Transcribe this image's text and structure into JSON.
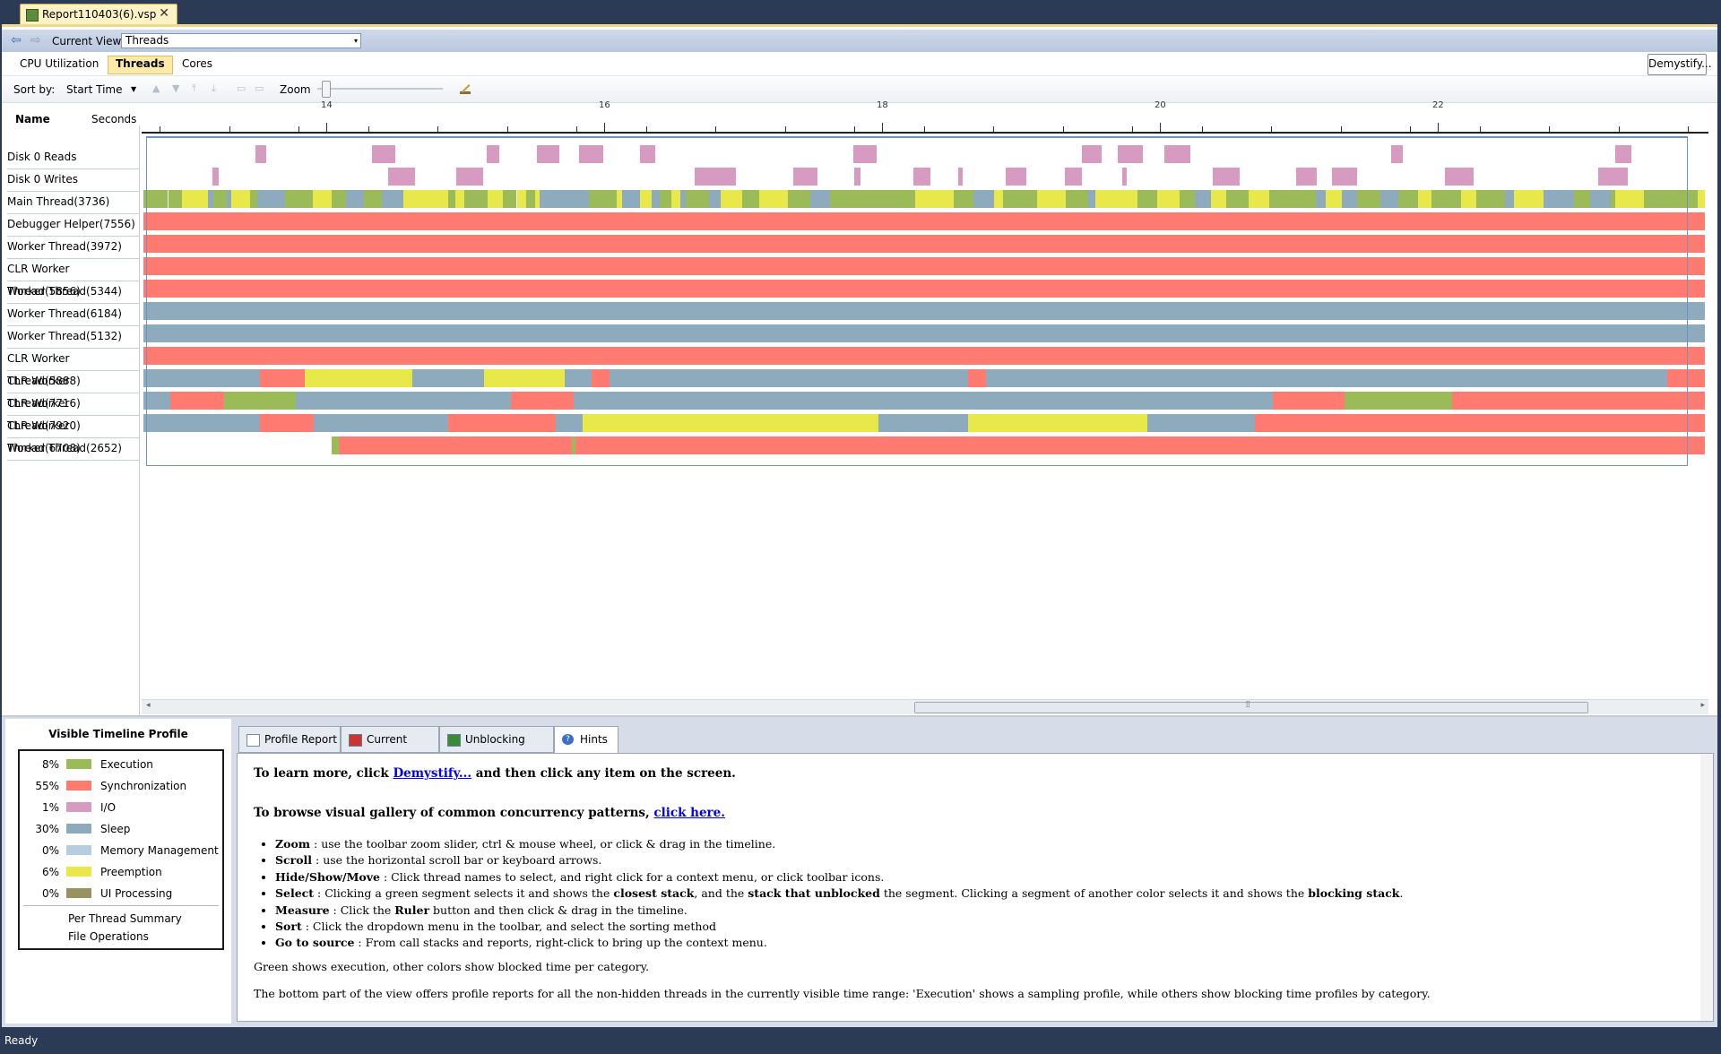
{
  "doc_tab": {
    "title": "Report110403(6).vsp",
    "close": "✕"
  },
  "view_bar": {
    "back": "⇦",
    "forward": "⇨",
    "label": "Current View:",
    "value": "Threads",
    "arrow": "▾"
  },
  "view_tabs": {
    "cpu": "CPU Utilization",
    "threads": "Threads",
    "cores": "Cores",
    "demystify": "Demystify..."
  },
  "toolbar": {
    "sort_label": "Sort by:",
    "sort_value": "Start Time",
    "zoom_label": "Zoom"
  },
  "header": {
    "name": "Name",
    "seconds": "Seconds"
  },
  "axis": {
    "ticks": [
      "14",
      "16",
      "18",
      "20",
      "22"
    ]
  },
  "threads": [
    "Disk 0 Reads",
    "Disk 0 Writes",
    "Main Thread(3736)",
    "Debugger Helper(7556)",
    "Worker Thread(3972)",
    "CLR Worker Thread(5856)",
    "Worker Thread(5344)",
    "Worker Thread(6184)",
    "Worker Thread(5132)",
    "CLR Worker Thread(5888)",
    "CLR Worker Thread(7716)",
    "CLR Worker Thread(7920)",
    "CLR Worker Thread(6708)",
    "Worker Thread(2652)"
  ],
  "colors": {
    "execution": "#9bbb59",
    "synchronization": "#ff7b72",
    "io": "#d79ac0",
    "sleep": "#8eaabd",
    "memory": "#b9cde0",
    "preemption": "#e8e84a",
    "ui": "#9a9161"
  },
  "profile": {
    "title": "Visible Timeline Profile",
    "legend": [
      {
        "pct": "8%",
        "name": "Execution",
        "color": "#9bbb59"
      },
      {
        "pct": "55%",
        "name": "Synchronization",
        "color": "#ff7b72"
      },
      {
        "pct": "1%",
        "name": "I/O",
        "color": "#d79ac0"
      },
      {
        "pct": "30%",
        "name": "Sleep",
        "color": "#8eaabd"
      },
      {
        "pct": "0%",
        "name": "Memory Management",
        "color": "#b9cde0"
      },
      {
        "pct": "6%",
        "name": "Preemption",
        "color": "#e8e84a"
      },
      {
        "pct": "0%",
        "name": "UI Processing",
        "color": "#9a9161"
      }
    ],
    "links": [
      "Per Thread Summary",
      "File Operations"
    ]
  },
  "report_tabs": [
    "Profile Report",
    "Current stack",
    "Unblocking stack",
    "Hints"
  ],
  "hints": {
    "l1_pre": "To learn more, click ",
    "l1_link": "Demystify...",
    "l1_post": " and then click any item on the screen.",
    "l2_pre": "To browse visual gallery of common concurrency patterns, ",
    "l2_link": "click here.",
    "bullets": [
      {
        "b": "Zoom",
        "t": " : use the toolbar zoom slider, ctrl & mouse wheel, or click & drag in the timeline."
      },
      {
        "b": "Scroll",
        "t": " : use the horizontal scroll bar or keyboard arrows."
      },
      {
        "b": "Hide/Show/Move",
        "t": " : Click thread names to select, and right click for a context menu, or click toolbar icons."
      },
      {
        "b": "Select",
        "t": " : Clicking a green segment selects it and shows the ",
        "b2": "closest stack",
        "t2": ", and the ",
        "b3": "stack that unblocked",
        "t3": " the segment. Clicking a segment of another color selects it and shows the ",
        "b4": "blocking stack",
        "t4": "."
      },
      {
        "b": "Measure",
        "t": " : Click the ",
        "b2": "Ruler",
        "t2": " button and then click & drag in the timeline."
      },
      {
        "b": "Sort",
        "t": " : Click the dropdown menu in the toolbar, and select the sorting method"
      },
      {
        "b": "Go to source",
        "t": " : From call stacks and reports, right-click to bring up the context menu."
      }
    ],
    "p1": "Green shows execution, other colors show blocked time per category.",
    "p2": "The bottom part of the view offers profile reports for all the non-hidden threads in the currently visible time range: 'Execution' shows a sampling profile, while others show blocking time profiles by category."
  },
  "status": "Ready"
}
